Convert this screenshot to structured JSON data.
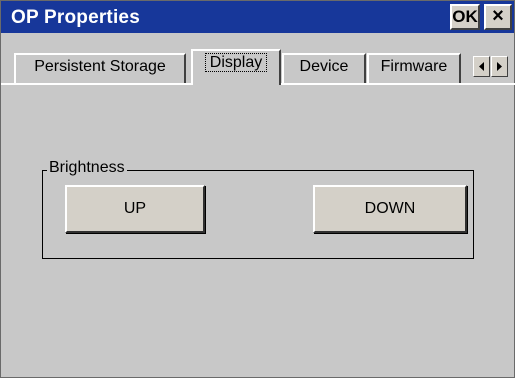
{
  "window": {
    "title": "OP Properties",
    "ok_label": "OK",
    "close_label": "×"
  },
  "tabs": [
    {
      "label": "Persistent Storage",
      "active": false
    },
    {
      "label": "Display",
      "active": true
    },
    {
      "label": "Device",
      "active": false
    },
    {
      "label": "Firmware",
      "active": false
    }
  ],
  "brightness": {
    "group_label": "Brightness",
    "up_label": "UP",
    "down_label": "DOWN"
  }
}
